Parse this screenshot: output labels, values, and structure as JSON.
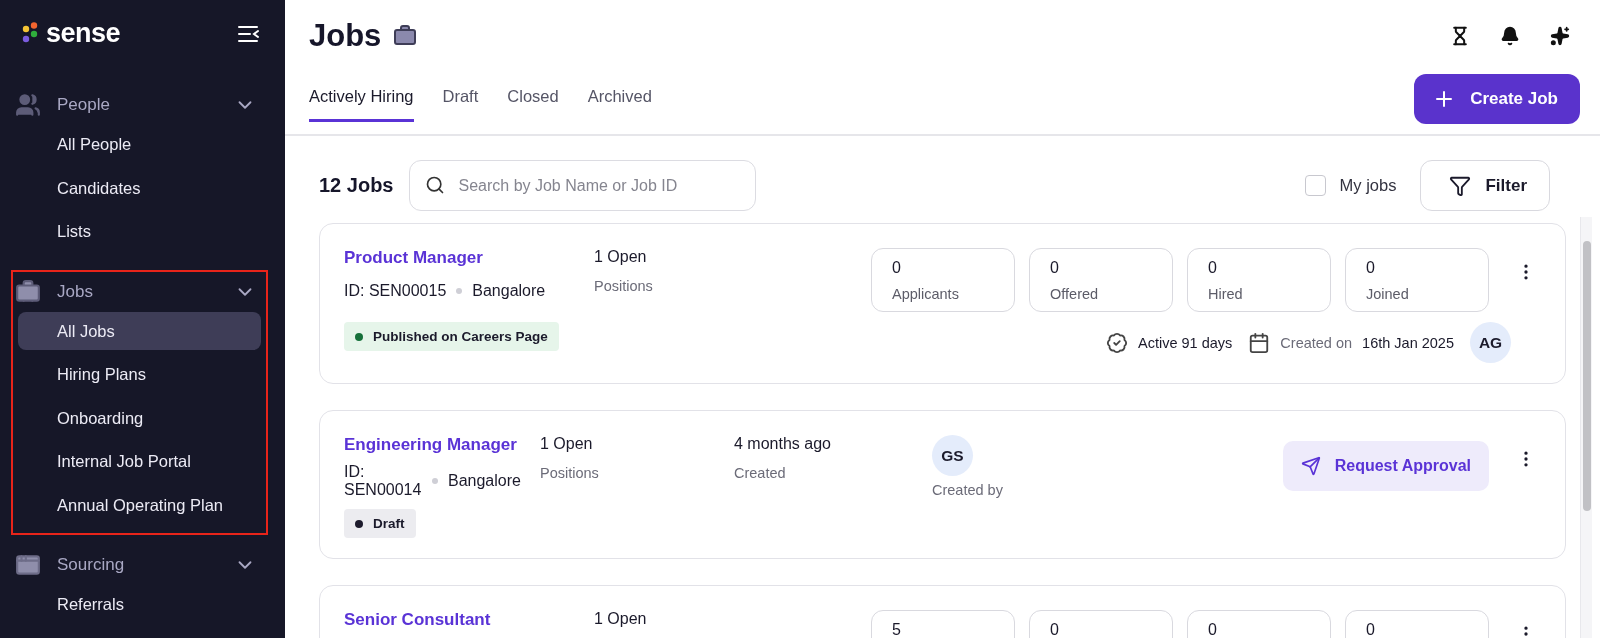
{
  "sidebar": {
    "logo": "sense",
    "sections": [
      {
        "label": "People",
        "expanded": true,
        "highlighted": false,
        "items": [
          {
            "label": "All People",
            "selected": false
          },
          {
            "label": "Candidates",
            "selected": false
          },
          {
            "label": "Lists",
            "selected": false
          }
        ]
      },
      {
        "label": "Jobs",
        "expanded": true,
        "highlighted": true,
        "items": [
          {
            "label": "All Jobs",
            "selected": true
          },
          {
            "label": "Hiring Plans",
            "selected": false
          },
          {
            "label": "Onboarding",
            "selected": false
          },
          {
            "label": "Internal Job Portal",
            "selected": false
          },
          {
            "label": "Annual Operating Plan",
            "selected": false
          }
        ]
      },
      {
        "label": "Sourcing",
        "expanded": true,
        "highlighted": false,
        "items": [
          {
            "label": "Referrals",
            "selected": false
          }
        ]
      }
    ]
  },
  "header": {
    "title": "Jobs"
  },
  "tabs": [
    {
      "label": "Actively Hiring",
      "selected": true
    },
    {
      "label": "Draft",
      "selected": false
    },
    {
      "label": "Closed",
      "selected": false
    },
    {
      "label": "Archived",
      "selected": false
    }
  ],
  "create_button": "Create Job",
  "toolbar": {
    "count": "12 Jobs",
    "search": {
      "placeholder": "Search by Job Name or Job ID"
    },
    "my_jobs": {
      "label": "My jobs",
      "checked": false
    },
    "filter": "Filter"
  },
  "jobs": [
    {
      "kind": "stats",
      "title": "Product Manager",
      "open": "1 Open",
      "positions": "Positions",
      "id": "ID: SEN00015",
      "location": "Bangalore",
      "status": {
        "label": "Published on Careers Page",
        "color": "#16703a"
      },
      "stats": [
        {
          "value": "0",
          "label": "Applicants"
        },
        {
          "value": "0",
          "label": "Offered"
        },
        {
          "value": "0",
          "label": "Hired"
        },
        {
          "value": "0",
          "label": "Joined"
        }
      ],
      "active": "Active 91 days",
      "created_prefix": "Created on",
      "created_date": "16th Jan 2025",
      "avatar": "AG"
    },
    {
      "kind": "draft",
      "title": "Engineering Manager",
      "open": "1 Open",
      "positions": "Positions",
      "id": "ID: SEN00014",
      "location": "Bangalore",
      "status": {
        "label": "Draft",
        "color": "#1d1b2c"
      },
      "created_ago": "4 months ago",
      "created_label": "Created",
      "avatar": "GS",
      "avatar_label": "Created by",
      "action": "Request Approval"
    },
    {
      "kind": "stats",
      "title": "Senior Consultant",
      "open": "1 Open",
      "stats": [
        {
          "value": "5"
        },
        {
          "value": "0"
        },
        {
          "value": "0"
        },
        {
          "value": "0"
        }
      ]
    }
  ]
}
